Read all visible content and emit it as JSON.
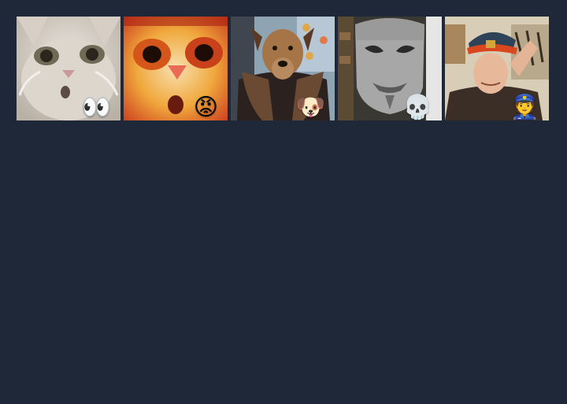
{
  "stickers": [
    {
      "name": "surprised-cat-sticker",
      "emoji": "👀",
      "badge_name": "eyes-emoji-badge"
    },
    {
      "name": "angry-cat-sticker",
      "emoji": "😡",
      "badge_name": "angry-face-emoji-badge"
    },
    {
      "name": "dog-in-coat-sticker",
      "emoji": "🐶",
      "badge_name": "dog-face-emoji-badge"
    },
    {
      "name": "mask-sticker",
      "emoji": "💀",
      "badge_name": "skull-emoji-badge"
    },
    {
      "name": "saluting-officer-sticker",
      "emoji": "👮",
      "badge_name": "police-officer-emoji-badge"
    }
  ],
  "colors": {
    "background": "#1f2839"
  }
}
